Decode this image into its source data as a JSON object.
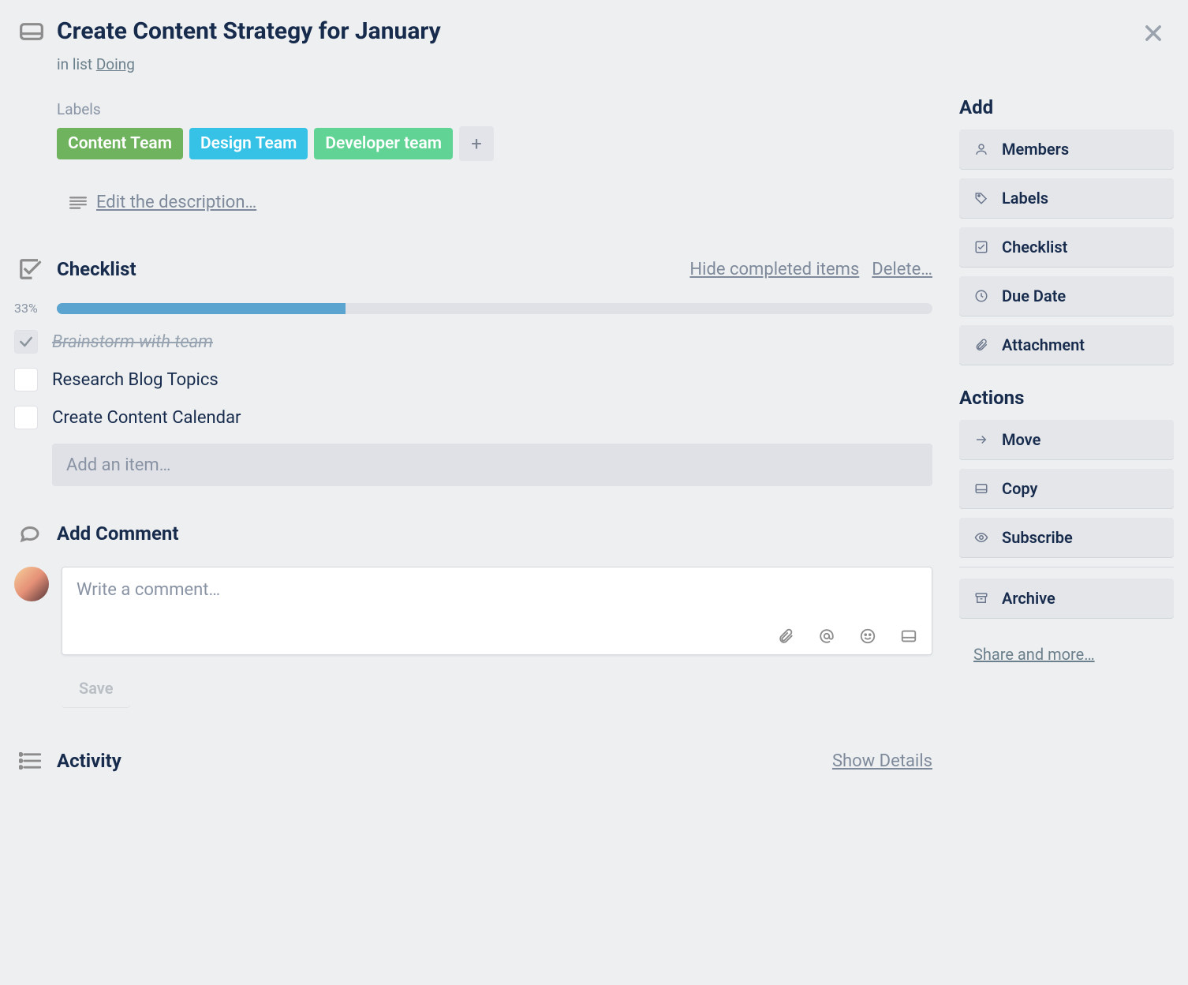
{
  "header": {
    "title": "Create Content Strategy for January",
    "in_list_prefix": "in list ",
    "list_name": "Doing"
  },
  "labels": {
    "title": "Labels",
    "items": [
      {
        "text": "Content Team",
        "color": "#70b35f"
      },
      {
        "text": "Design Team",
        "color": "#35c2e6"
      },
      {
        "text": "Developer team",
        "color": "#61d495"
      }
    ]
  },
  "description": {
    "edit_text": "Edit the description…"
  },
  "checklist": {
    "title": "Checklist",
    "hide": "Hide completed items",
    "delete": "Delete…",
    "progress_pct": "33%",
    "progress_value": 33,
    "items": [
      {
        "text": "Brainstorm with team",
        "done": true
      },
      {
        "text": "Research Blog Topics",
        "done": false
      },
      {
        "text": "Create Content Calendar",
        "done": false
      }
    ],
    "add_placeholder": "Add an item…"
  },
  "comment": {
    "title": "Add Comment",
    "placeholder": "Write a comment…",
    "save": "Save"
  },
  "activity": {
    "title": "Activity",
    "show_details": "Show Details"
  },
  "sidebar": {
    "add_title": "Add",
    "add_buttons": [
      "Members",
      "Labels",
      "Checklist",
      "Due Date",
      "Attachment"
    ],
    "actions_title": "Actions",
    "action_buttons": [
      "Move",
      "Copy",
      "Subscribe",
      "Archive"
    ],
    "share": "Share and more…"
  }
}
